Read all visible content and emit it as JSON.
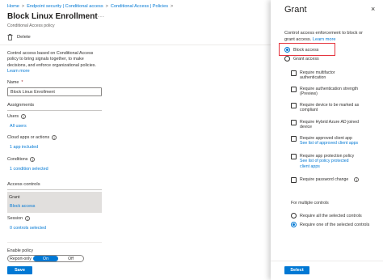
{
  "breadcrumb": {
    "items": [
      "Home",
      "Endpoint security | Conditional access",
      "Conditional Access | Policies"
    ],
    "separator": ">"
  },
  "policy": {
    "title": "Block Linux Enrollment",
    "more": "...",
    "subtitle": "Conditional Access policy",
    "delete_label": "Delete",
    "description_1": "Control access based on Conditional Access policy to bring signals together, to make decisions, and enforce organizational policies.",
    "learn_more": "Learn more"
  },
  "name_field": {
    "label": "Name",
    "required": "*",
    "value": "Block Linux Enrollment"
  },
  "assignments": {
    "heading": "Assignments",
    "users_label": "Users",
    "users_value": "All users",
    "cloud_label": "Cloud apps or actions",
    "cloud_value": "1 app included",
    "conditions_label": "Conditions",
    "conditions_value": "1 condition selected"
  },
  "access_controls": {
    "heading": "Access controls",
    "grant_label": "Grant",
    "grant_value": "Block access",
    "session_label": "Session",
    "session_value": "0 controls selected"
  },
  "enable_policy": {
    "label": "Enable policy",
    "options": [
      "Report-only",
      "On",
      "Off"
    ],
    "selected": "On",
    "save_label": "Save"
  },
  "grant_panel": {
    "title": "Grant",
    "close": "×",
    "description": "Control access enforcement to block or grant access.",
    "learn_more": "Learn more",
    "block_access": "Block access",
    "grant_access": "Grant access",
    "controls": [
      {
        "label": "Require multifactor authentication",
        "link": ""
      },
      {
        "label": "Require authentication strength (Preview)",
        "link": ""
      },
      {
        "label": "Require device to be marked as compliant",
        "link": ""
      },
      {
        "label": "Require Hybrid Azure AD joined device",
        "link": ""
      },
      {
        "label": "Require approved client app",
        "link": "See list of approved client apps"
      },
      {
        "label": "Require app protection policy",
        "link": "See list of policy protected client apps"
      },
      {
        "label": "Require password change",
        "link": ""
      }
    ],
    "multiple_label": "For multiple controls",
    "require_all": "Require all the selected controls",
    "require_one": "Require one of the selected controls",
    "select_label": "Select"
  },
  "colors": {
    "accent": "#0078d4",
    "highlight": "#e4333d"
  }
}
